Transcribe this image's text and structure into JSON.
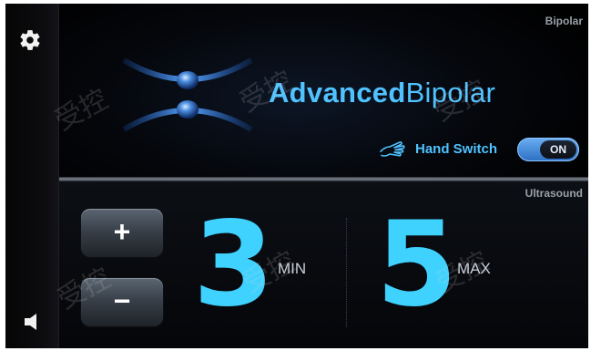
{
  "sidebar": {
    "top_icon": "gear-icon",
    "bottom_icon": "speaker-icon"
  },
  "header": {
    "mode_tag": "Bipolar"
  },
  "product": {
    "name_bold": "Advanced",
    "name_regular": "Bipolar",
    "accent_color": "#4fc2ff"
  },
  "hand_switch": {
    "icon": "hand-icon",
    "label": "Hand Switch",
    "toggle_state": "ON"
  },
  "ultrasound": {
    "mode_tag": "Ultrasound",
    "increase_label": "+",
    "decrease_label": "−",
    "min_value": "3",
    "min_unit": "MIN",
    "max_value": "5",
    "max_unit": "MAX",
    "value_color": "#3fd2ff"
  },
  "watermark_text": "受控"
}
